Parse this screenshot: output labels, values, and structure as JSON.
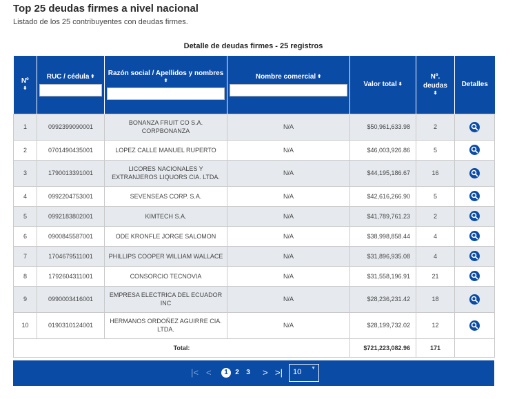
{
  "page": {
    "title": "Top 25 deudas firmes a nivel nacional",
    "subtitle": "Listado de los 25 contribuyentes con deudas firmes."
  },
  "table": {
    "caption": "Detalle de deudas firmes - 25 registros",
    "columns": {
      "no": "Nº",
      "ruc": "RUC / cédula",
      "razon": "Razón social / Apellidos y nombres",
      "comercial": "Nombre comercial",
      "valor": "Valor total",
      "deudas": "Nº. deudas",
      "detalles": "Detalles"
    },
    "sort_glyph": "⬍",
    "rows": [
      {
        "no": "1",
        "ruc": "0992399090001",
        "razon": "BONANZA FRUIT CO S.A. CORPBONANZA",
        "comercial": "N/A",
        "valor": "$50,961,633.98",
        "deudas": "2"
      },
      {
        "no": "2",
        "ruc": "0701490435001",
        "razon": "LOPEZ CALLE MANUEL RUPERTO",
        "comercial": "N/A",
        "valor": "$46,003,926.86",
        "deudas": "5"
      },
      {
        "no": "3",
        "ruc": "1790013391001",
        "razon": "LICORES NACIONALES Y EXTRANJEROS LIQUORS CIA. LTDA.",
        "comercial": "N/A",
        "valor": "$44,195,186.67",
        "deudas": "16"
      },
      {
        "no": "4",
        "ruc": "0992204753001",
        "razon": "SEVENSEAS CORP. S.A.",
        "comercial": "N/A",
        "valor": "$42,616,266.90",
        "deudas": "5"
      },
      {
        "no": "5",
        "ruc": "0992183802001",
        "razon": "KIMTECH S.A.",
        "comercial": "N/A",
        "valor": "$41,789,761.23",
        "deudas": "2"
      },
      {
        "no": "6",
        "ruc": "0900845587001",
        "razon": "ODE KRONFLE JORGE SALOMON",
        "comercial": "N/A",
        "valor": "$38,998,858.44",
        "deudas": "4"
      },
      {
        "no": "7",
        "ruc": "1704679511001",
        "razon": "PHILLIPS COOPER WILLIAM WALLACE",
        "comercial": "N/A",
        "valor": "$31,896,935.08",
        "deudas": "4"
      },
      {
        "no": "8",
        "ruc": "1792604311001",
        "razon": "CONSORCIO TECNOVIA",
        "comercial": "N/A",
        "valor": "$31,558,196.91",
        "deudas": "21"
      },
      {
        "no": "9",
        "ruc": "0990003416001",
        "razon": "EMPRESA ELECTRICA DEL ECUADOR INC",
        "comercial": "N/A",
        "valor": "$28,236,231.42",
        "deudas": "18"
      },
      {
        "no": "10",
        "ruc": "0190310124001",
        "razon": "HERMANOS ORDOÑEZ AGUIRRE CIA. LTDA.",
        "comercial": "N/A",
        "valor": "$28,199,732.02",
        "deudas": "12"
      }
    ],
    "total": {
      "label": "Total:",
      "valor": "$721,223,082.96",
      "deudas": "171"
    },
    "detail_icon": "magnifier-icon"
  },
  "pager": {
    "first": "|<",
    "prev": "<",
    "pages": [
      "1",
      "2",
      "3"
    ],
    "current": "1",
    "next": ">",
    "last": ">|",
    "page_size": "10"
  },
  "colors": {
    "header": "#0a4ba6",
    "row_alt": "#e6e9ee"
  }
}
